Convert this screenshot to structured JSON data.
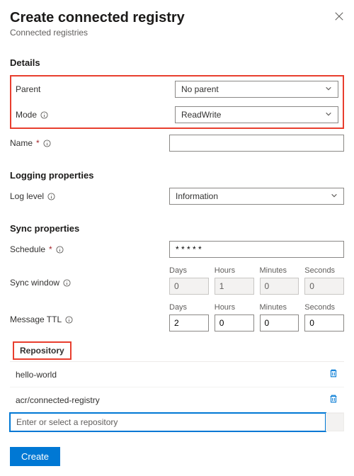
{
  "header": {
    "title": "Create connected registry",
    "subtitle": "Connected registries"
  },
  "sections": {
    "details": "Details",
    "logging": "Logging properties",
    "sync": "Sync properties"
  },
  "labels": {
    "parent": "Parent",
    "mode": "Mode",
    "name": "Name",
    "loglevel": "Log level",
    "schedule": "Schedule",
    "syncwindow": "Sync window",
    "messagettl": "Message TTL",
    "days": "Days",
    "hours": "Hours",
    "minutes": "Minutes",
    "seconds": "Seconds",
    "repository": "Repository"
  },
  "values": {
    "parent": "No parent",
    "mode": "ReadWrite",
    "name": "",
    "loglevel": "Information",
    "schedule": "* * * * *",
    "syncwindow": {
      "days": "0",
      "hours": "1",
      "minutes": "0",
      "seconds": "0"
    },
    "messagettl": {
      "days": "2",
      "hours": "0",
      "minutes": "0",
      "seconds": "0"
    }
  },
  "repos": {
    "items": [
      "hello-world",
      "acr/connected-registry"
    ],
    "placeholder": "Enter or select a repository"
  },
  "buttons": {
    "create": "Create"
  }
}
